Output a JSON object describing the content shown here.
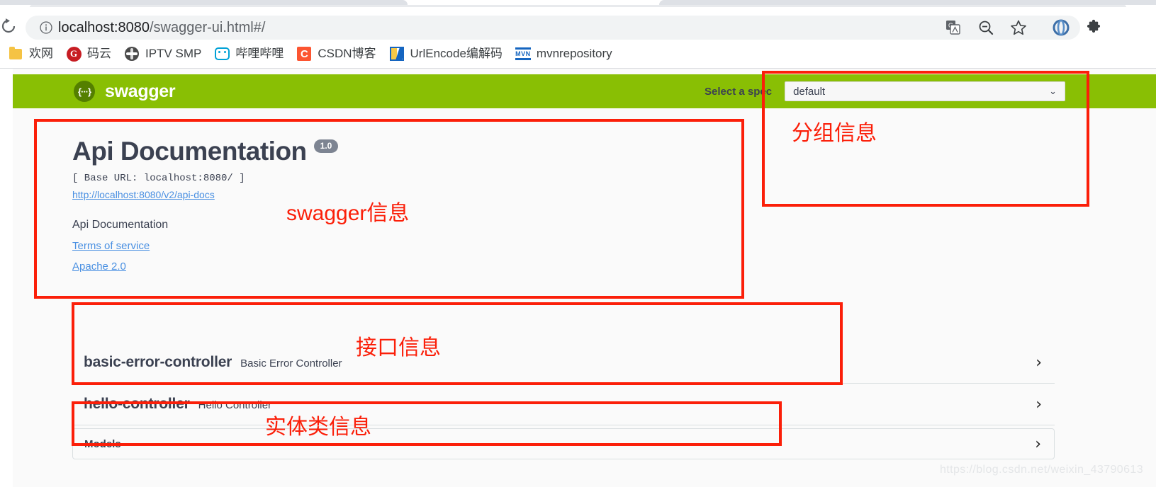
{
  "browser": {
    "url_prefix": "localhost:8080",
    "url_suffix": "/swagger-ui.html#/",
    "reload_tooltip": "Reload",
    "omnibox_icons": [
      {
        "name": "translate-icon",
        "glyph": "文"
      },
      {
        "name": "zoom-out-icon",
        "glyph": "⊖"
      },
      {
        "name": "bookmark-star-icon",
        "glyph": "☆"
      }
    ],
    "extension_icons": [
      {
        "name": "profile-circle-icon",
        "glyph": "◌"
      },
      {
        "name": "extensions-puzzle-icon",
        "glyph": "❖"
      }
    ],
    "bookmarks": [
      {
        "label": "欢网",
        "icon": "folder-icon",
        "icon_class": "ic-folder",
        "glyph": ""
      },
      {
        "label": "码云",
        "icon": "gitee-icon",
        "icon_class": "ic-gitee",
        "glyph": "G"
      },
      {
        "label": "IPTV SMP",
        "icon": "globe-icon",
        "icon_class": "ic-globe",
        "glyph": ""
      },
      {
        "label": "哔哩哔哩",
        "icon": "bilibili-tv-icon",
        "icon_class": "ic-bili",
        "glyph": ""
      },
      {
        "label": "CSDN博客",
        "icon": "csdn-icon",
        "icon_class": "ic-csdn",
        "glyph": "C"
      },
      {
        "label": "UrlEncode编解码",
        "icon": "urlencode-icon",
        "icon_class": "ic-urlenc",
        "glyph": ""
      },
      {
        "label": "mvnrepository",
        "icon": "maven-icon",
        "icon_class": "ic-mvn",
        "glyph": "MVN"
      }
    ]
  },
  "swagger": {
    "logo_glyph": "{···}",
    "logo_text": "swagger",
    "spec_label": "Select a spec",
    "spec_value": "default",
    "spec_chevron": "⌄",
    "brand_green": "#89bf04",
    "logo_dark_green": "#547f00"
  },
  "info": {
    "title": "Api Documentation",
    "version": "1.0",
    "base_url": "[ Base URL: localhost:8080/ ]",
    "api_docs_link": "http://localhost:8080/v2/api-docs",
    "description": "Api Documentation",
    "terms_link": "Terms of service",
    "license_link": "Apache 2.0"
  },
  "tags": [
    {
      "name": "basic-error-controller",
      "description": "Basic Error Controller",
      "chevron": "›"
    },
    {
      "name": "hello-controller",
      "description": "Hello Controller",
      "chevron": "›"
    }
  ],
  "models": {
    "title": "Models",
    "chevron": "›"
  },
  "annotations": {
    "accent_color": "#fb1f09",
    "swagger_info": "swagger信息",
    "group_info": "分组信息",
    "api_info": "接口信息",
    "model_info": "实体类信息"
  },
  "watermark": "https://blog.csdn.net/weixin_43790613"
}
